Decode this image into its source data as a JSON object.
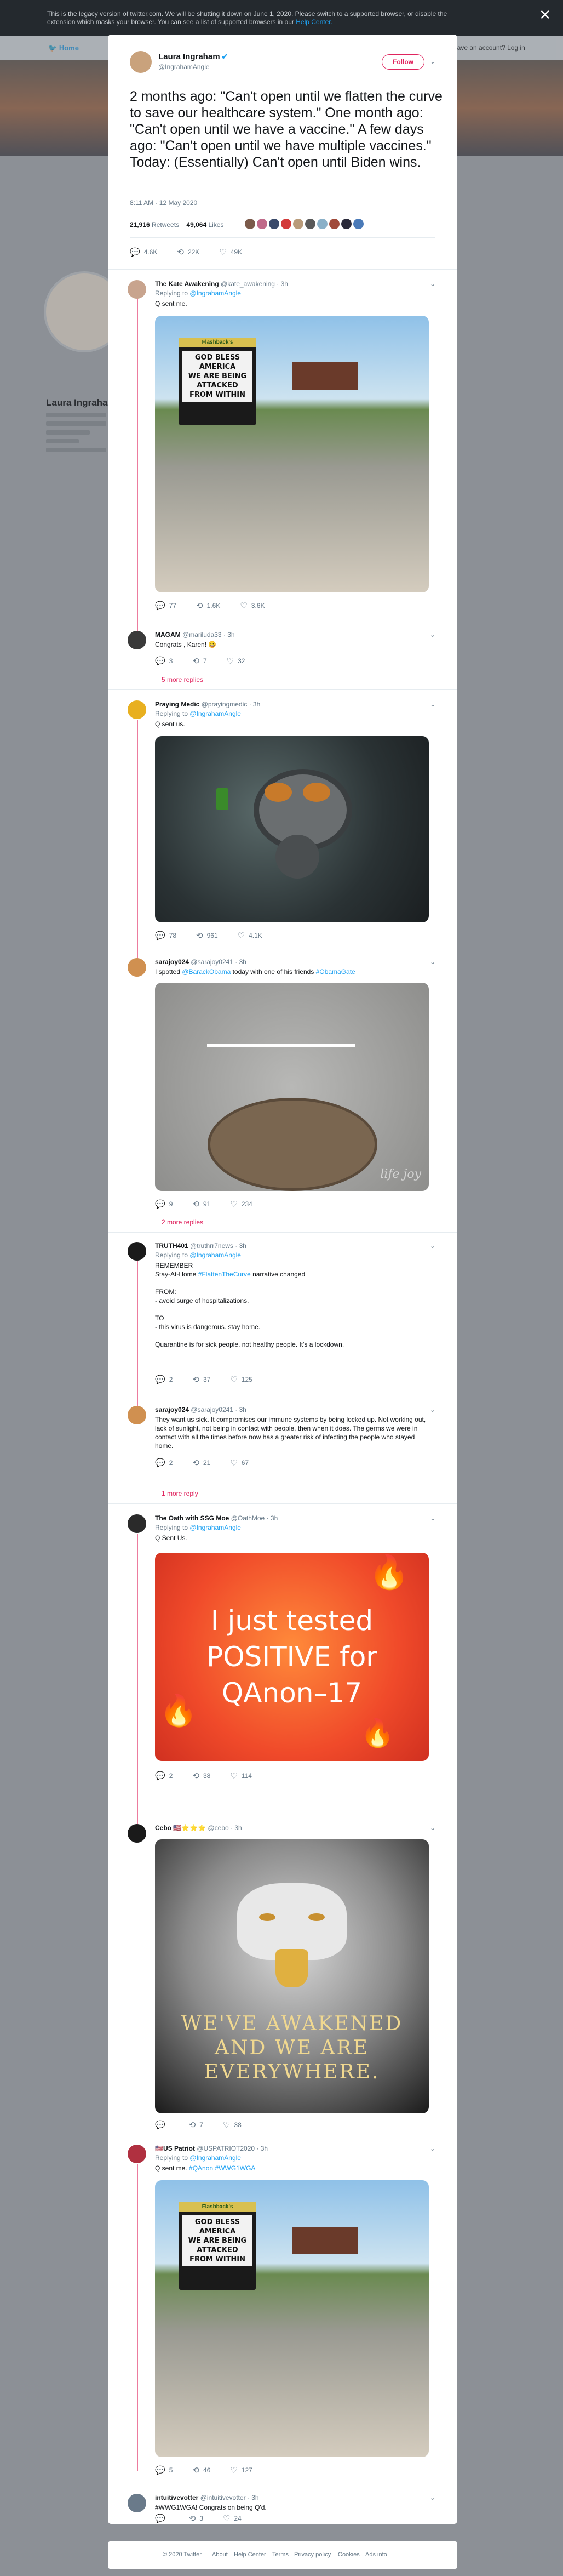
{
  "banner": {
    "text_line1": "This is the legacy version of twitter.com. We will be shutting it down on June 1, 2020. Please switch to a supported browser, or disable the",
    "text_line2": "extension which masks your browser. You can see a list of supported browsers in our",
    "help_link": "Help Center."
  },
  "nav": {
    "home": "Home",
    "login": "Have an account? Log in"
  },
  "profile_bg": {
    "name": "Laura Ingraham"
  },
  "main_tweet": {
    "name": "Laura Ingraham",
    "handle": "@IngrahamAngle",
    "follow_label": "Follow",
    "text": "2 months ago: \"Can't open until we flatten the curve to save our healthcare system.\" One month ago: \"Can't open until we have a vaccine.\" A few days ago: \"Can't open until we have multiple vaccines.\"  Today: (Essentially) Can't open until Biden wins.",
    "timestamp": "8:11 AM - 12 May 2020",
    "retweets_count": "21,916",
    "retweets_label": "Retweets",
    "likes_count": "49,064",
    "likes_label": "Likes",
    "reply_count": "4.6K",
    "retweet_count": "22K",
    "like_count": "49K"
  },
  "replies": [
    {
      "name": "The Kate Awakening",
      "handle": "@kate_awakening · 3h",
      "replying_label": "Replying to",
      "replying_to": "@IngrahamAngle",
      "text": "Q sent me.",
      "media_caption": [
        "GOD BLESS AMERICA",
        "WE ARE BEING",
        "ATTACKED",
        "FROM WITHIN"
      ],
      "sign_header": "Flashback's",
      "counts": [
        "77",
        "1.6K",
        "3.6K"
      ]
    },
    {
      "name": "MAGAM",
      "handle": "@mariluda33 · 3h",
      "text": "Congrats , Karen! 😀",
      "counts": [
        "3",
        "7",
        "32"
      ],
      "more": "5 more replies"
    },
    {
      "name": "Praying Medic",
      "handle": "@prayingmedic · 3h",
      "replying_label": "Replying to",
      "replying_to": "@IngrahamAngle",
      "text": "Q sent us.",
      "counts": [
        "78",
        "961",
        "4.1K"
      ]
    },
    {
      "name": "sarajoy024",
      "handle": "@sarajoy0241 · 3h",
      "text_before": "I spotted ",
      "text_link1": "@BarackObama",
      "text_mid": " today with one of his friends ",
      "text_link2": "#ObamaGate",
      "counts": [
        "9",
        "91",
        "234"
      ],
      "watermark": "life joy",
      "more": "2 more replies"
    },
    {
      "name": "TRUTH401",
      "handle": "@truthrr7news · 3h",
      "replying_label": "Replying to",
      "replying_to": "@IngrahamAngle",
      "lines": [
        "REMEMBER",
        "Stay-At-Home ",
        "#FlattenTheCurve",
        " narrative changed",
        "FROM:",
        "- avoid surge of hospitalizations.",
        "TO",
        "- this virus is dangerous. stay home.",
        "Quarantine is for sick people. not healthy people. It's a lockdown."
      ],
      "counts": [
        "2",
        "37",
        "125"
      ]
    },
    {
      "name": "sarajoy024",
      "handle": "@sarajoy0241 · 3h",
      "text": "They want us sick. It compromises our immune systems by being locked up. Not working out, lack of sunlight, not being in contact with people, then when it does. The germs we were in contact with all the times before now has a greater risk of infecting the people who stayed home.",
      "counts": [
        "2",
        "21",
        "67"
      ],
      "more": "1 more reply"
    },
    {
      "name": "The Oath with SSG Moe",
      "handle": "@OathMoe · 3h",
      "replying_label": "Replying to",
      "replying_to": "@IngrahamAngle",
      "text": "Q Sent Us.",
      "media_lines": [
        "I just tested",
        "POSITIVE for",
        "QAnon–17"
      ],
      "counts": [
        "2",
        "38",
        "114"
      ]
    },
    {
      "name": "Cebo",
      "handle": "@cebo · 3h",
      "media_lines": [
        "WE'VE AWAKENED",
        "AND WE ARE",
        "EVERYWHERE."
      ],
      "counts": [
        "",
        "7",
        "38"
      ]
    },
    {
      "name": "US Patriot",
      "handle": "@USPATRIOT2020 · 3h",
      "replying_label": "Replying to",
      "replying_to": "@IngrahamAngle",
      "text_before": "Q sent me. ",
      "text_link1": "#QAnon",
      "text_mid": " ",
      "text_link2": "#WWG1WGA",
      "media_caption": [
        "GOD BLESS AMERICA",
        "WE ARE BEING",
        "ATTACKED",
        "FROM WITHIN"
      ],
      "sign_header": "Flashback's",
      "counts": [
        "5",
        "46",
        "127"
      ]
    },
    {
      "name": "intuitivevotter",
      "handle": "@intuitivevotter · 3h",
      "text": "#WWG1WGA!  Congrats on being Q'd.",
      "counts": [
        "",
        "3",
        "24"
      ]
    }
  ],
  "footer": {
    "copyright": "© 2020 Twitter",
    "links": [
      "About",
      "Help Center",
      "Terms",
      "Privacy policy",
      "Cookies",
      "Ads info"
    ]
  }
}
